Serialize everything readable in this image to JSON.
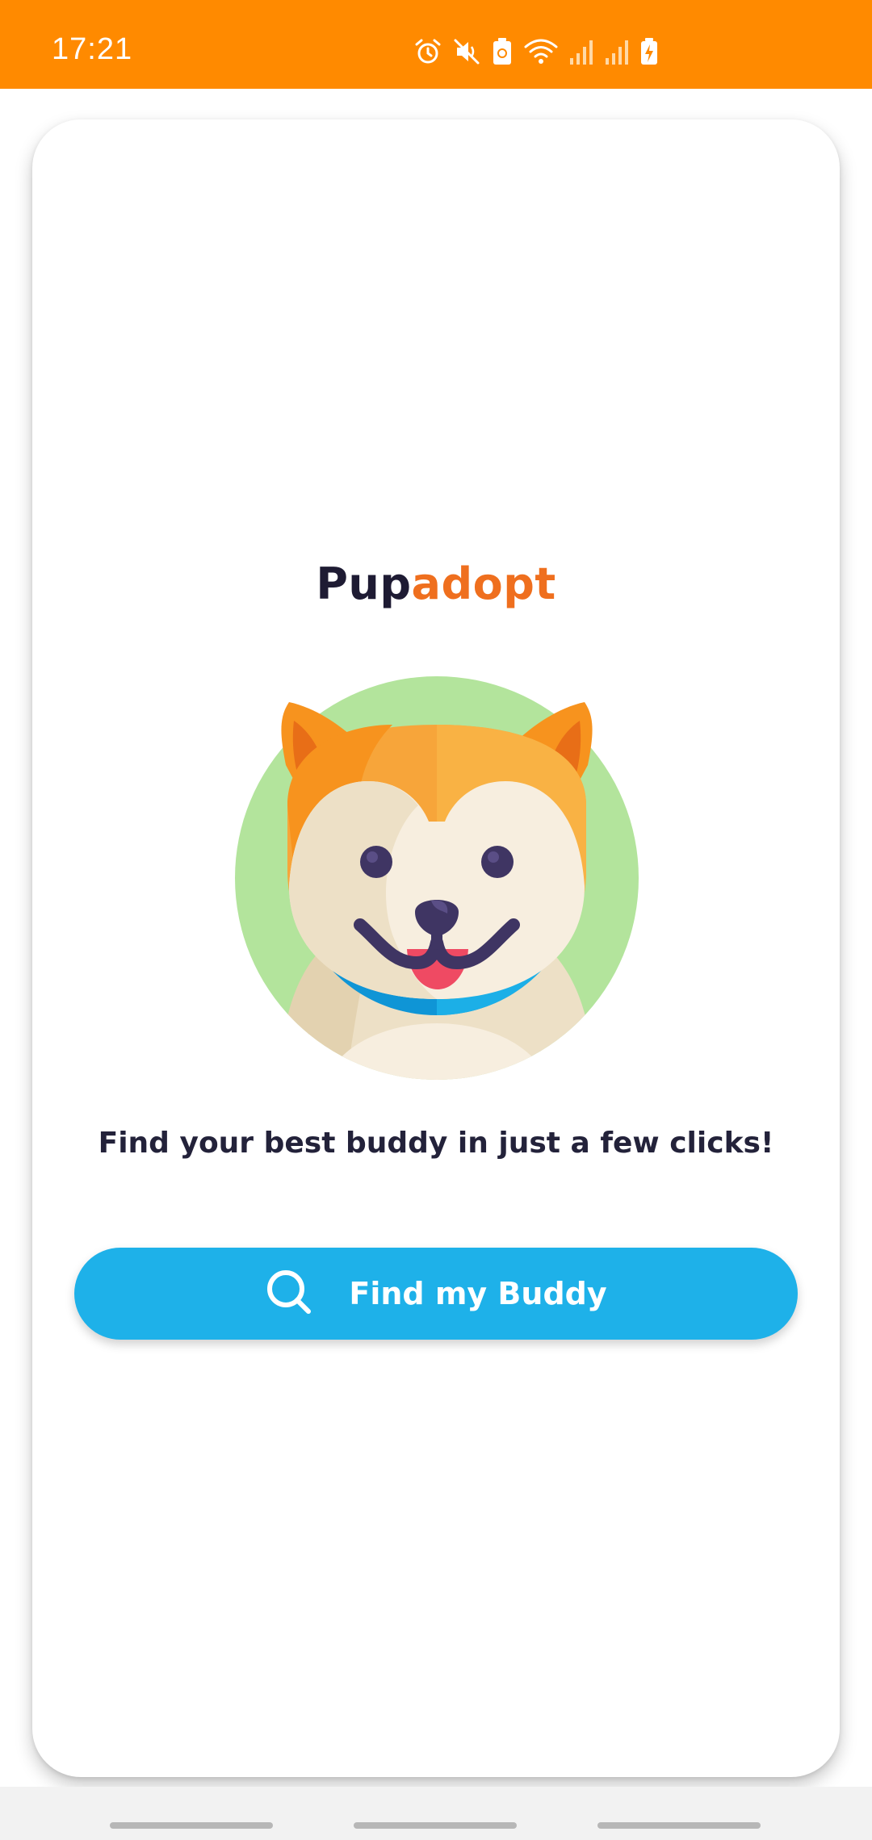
{
  "status_bar": {
    "time": "17:21",
    "background": "#FF8A00",
    "icons": [
      "alarm-icon",
      "mute-icon",
      "battery-saver-icon",
      "wifi-icon",
      "signal-icon",
      "signal-icon",
      "battery-charging-icon"
    ]
  },
  "app": {
    "brand_part1": "Pup",
    "brand_part2": "adopt",
    "brand_colors": {
      "dark": "#1E1B33",
      "accent": "#EF6F1E"
    },
    "illustration": "dog-face-icon",
    "tagline": "Find your best buddy in just a few clicks!",
    "cta": {
      "label": "Find my Buddy",
      "icon": "search-icon",
      "color": "#1EB1E9"
    }
  },
  "nav_bar": {
    "handles": [
      "nav-handle-left",
      "nav-handle-center",
      "nav-handle-right"
    ]
  }
}
